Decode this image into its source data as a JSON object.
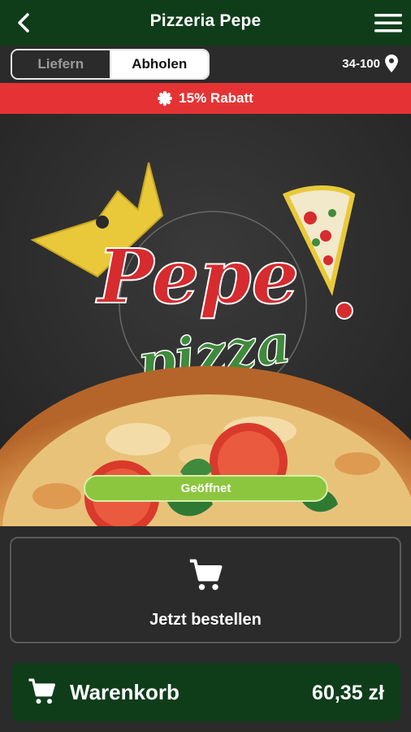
{
  "header": {
    "title": "Pizzeria Pepe",
    "back_icon": "chevron-left-icon",
    "menu_icon": "hamburger-menu-icon"
  },
  "mode_toggle": {
    "options": [
      "Liefern",
      "Abholen"
    ],
    "selected": "Abholen"
  },
  "location": {
    "postal_code": "34-100",
    "icon": "location-pin-icon"
  },
  "promo": {
    "text": "15% Rabatt",
    "icon": "badge-icon",
    "color": "#e53335"
  },
  "hero": {
    "logo_text_main": "Pepe",
    "logo_text_sub": "pizza",
    "status": "Geöffnet",
    "status_color": "#8cc63f"
  },
  "order": {
    "label": "Jetzt bestellen",
    "icon": "cart-icon"
  },
  "cart": {
    "label": "Warenkorb",
    "total": "60,35 zł",
    "icon": "cart-icon"
  },
  "colors": {
    "brand_dark_green": "#0f3d1a",
    "background": "#2b2b2b"
  }
}
